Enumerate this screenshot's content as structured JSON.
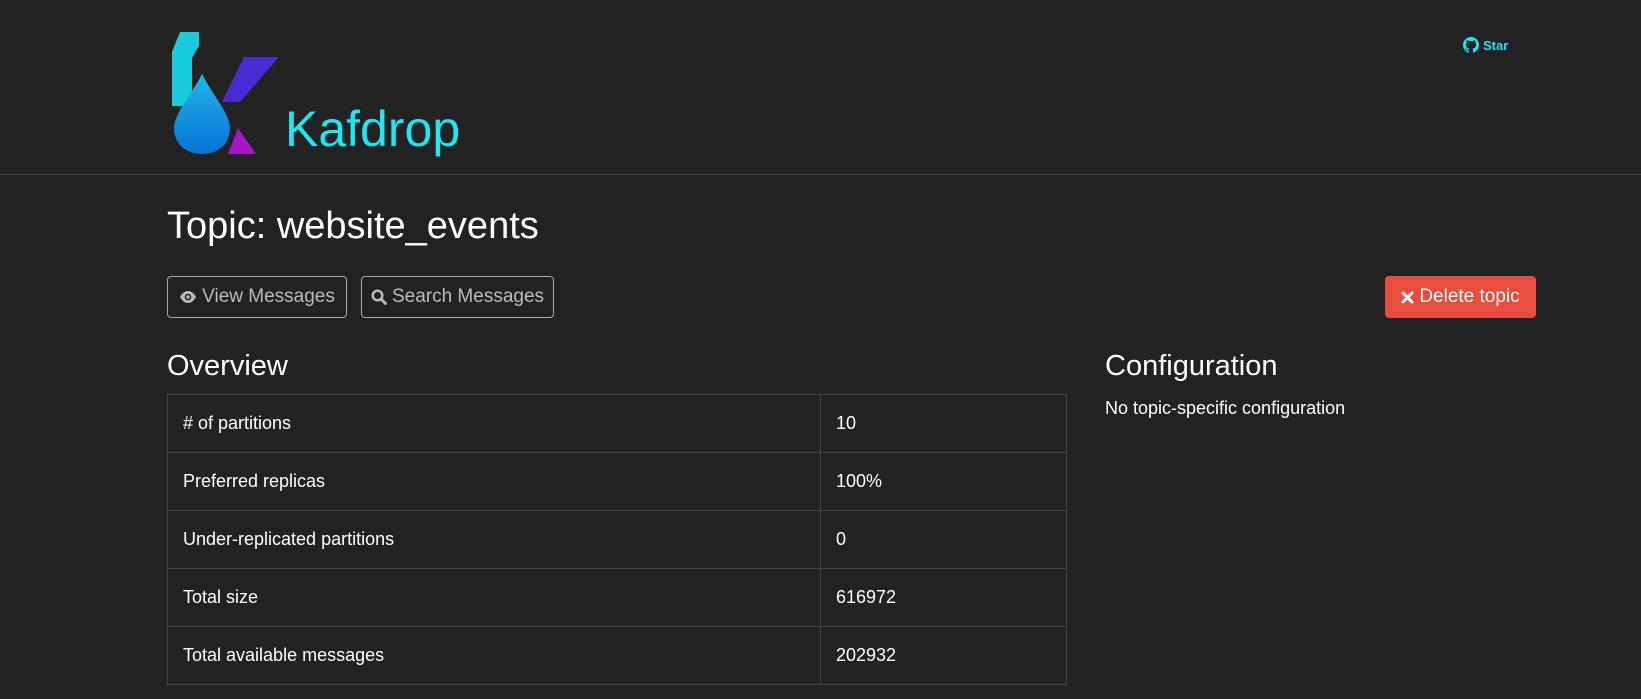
{
  "header": {
    "brand": "Kafdrop",
    "star_label": "Star",
    "logo_icon": "kafdrop-logo",
    "star_icon": "github-icon"
  },
  "page": {
    "title": "Topic: website_events"
  },
  "actions": {
    "view_messages": "View Messages",
    "search_messages": "Search Messages",
    "delete_topic": "Delete topic",
    "delete_color": "#e74c3c"
  },
  "overview": {
    "title": "Overview",
    "rows": [
      {
        "key": "# of partitions",
        "value": "10"
      },
      {
        "key": "Preferred replicas",
        "value": "100%"
      },
      {
        "key": "Under-replicated partitions",
        "value": "0"
      },
      {
        "key": "Total size",
        "value": "616972"
      },
      {
        "key": "Total available messages",
        "value": "202932"
      }
    ]
  },
  "configuration": {
    "title": "Configuration",
    "text": "No topic-specific configuration"
  },
  "colors": {
    "background": "#222222",
    "brand": "#1ee6f2",
    "border": "#444444"
  }
}
